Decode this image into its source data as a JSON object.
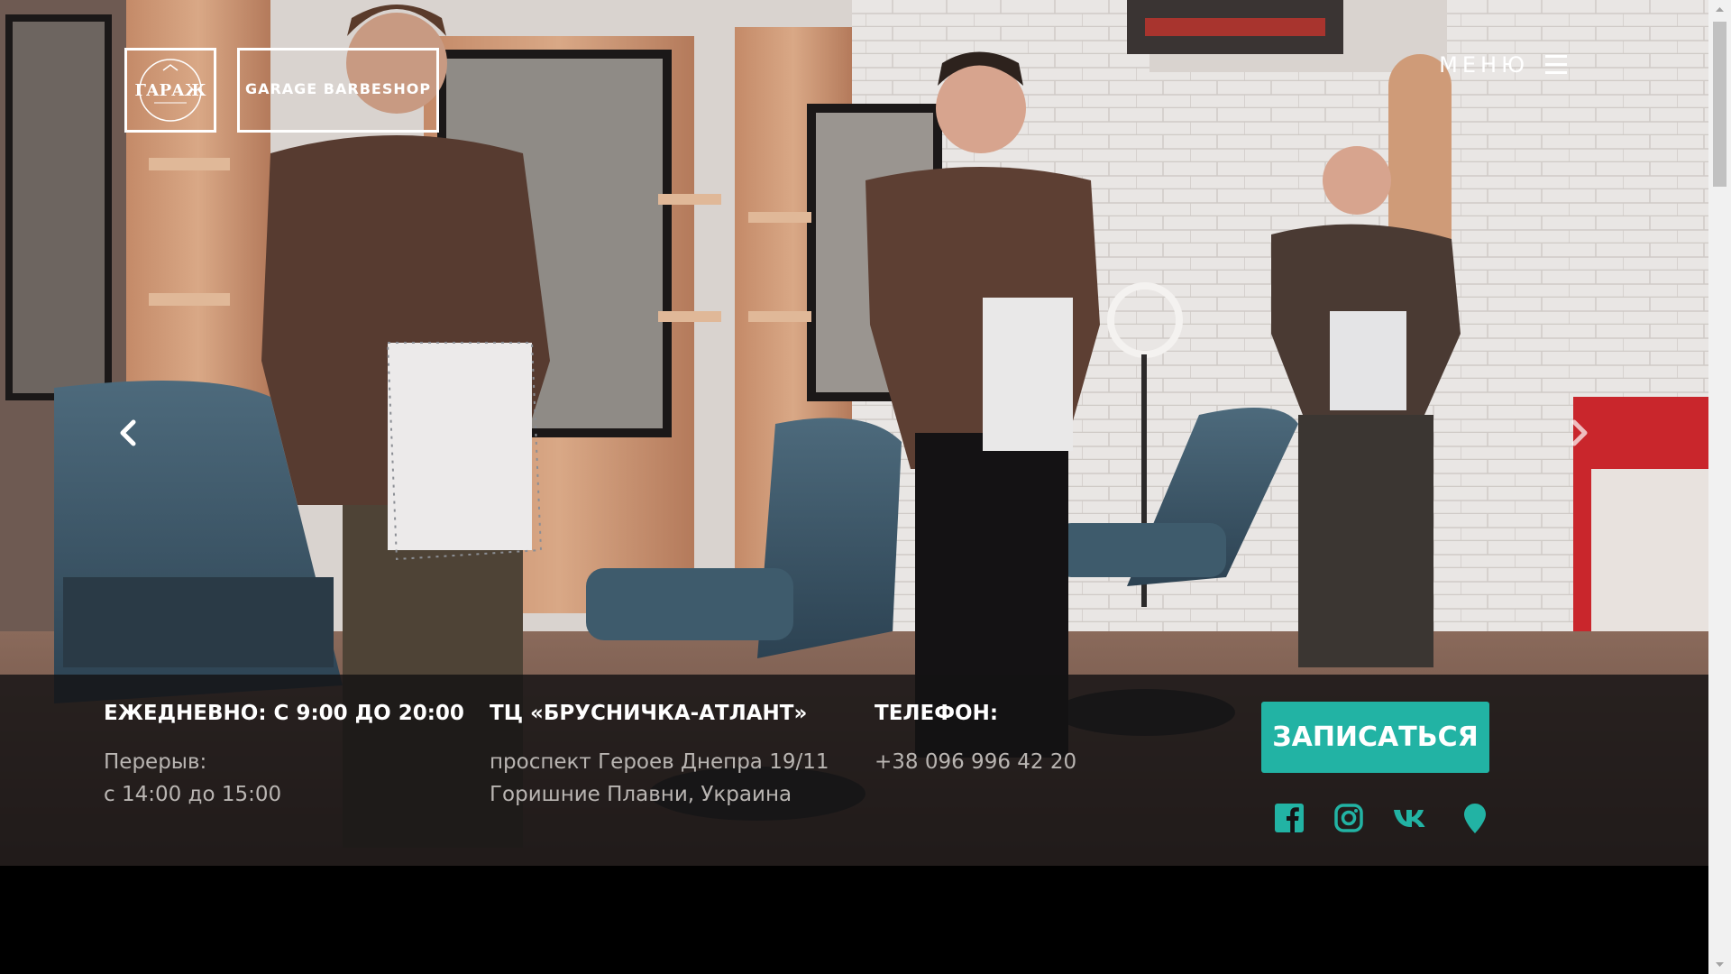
{
  "header": {
    "logo_text": "ГАРАЖ",
    "brand_name": "GARAGE BARBESHOP",
    "menu_label": "МЕНЮ"
  },
  "info": {
    "hours_title": "ЕЖЕДНЕВНО: С 9:00 ДО 20:00",
    "break_label": "Перерыв:",
    "break_time": "с 14:00 до 15:00",
    "location_title": "ТЦ «БРУСНИЧКА-АТЛАНТ»",
    "address_line1": "проспект Героев Днепра 19/11",
    "address_line2": "Горишние Плавни, Украина",
    "phone_title": "ТЕЛЕФОН:",
    "phone_number": "+38 096 996 42 20"
  },
  "cta": {
    "book_label": "ЗАПИСАТЬСЯ"
  },
  "socials": [
    {
      "icon": "facebook-icon"
    },
    {
      "icon": "instagram-icon"
    },
    {
      "icon": "vk-icon"
    },
    {
      "icon": "map-pin-icon"
    }
  ],
  "colors": {
    "accent": "#22b3a4",
    "info_bar_bg": "#141214",
    "muted_text": "#b9b5b2"
  }
}
